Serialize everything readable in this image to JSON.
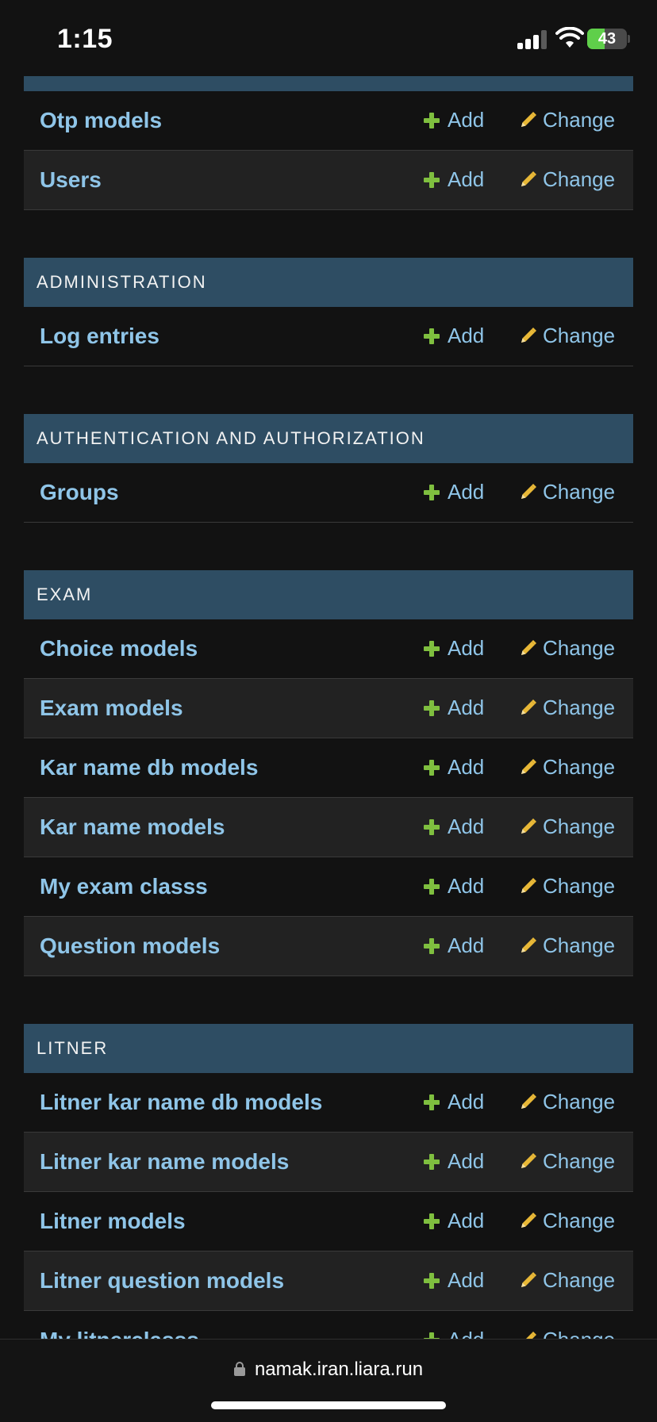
{
  "status": {
    "time": "1:15",
    "battery": "43",
    "battery_level": 0.43
  },
  "colors": {
    "header_bg": "#2e4d63",
    "link": "#8fc5e8",
    "add_icon": "#7fbf3f",
    "change_icon": "#e8b837",
    "background": "#121212"
  },
  "common": {
    "add_label": "Add",
    "change_label": "Change"
  },
  "top_module": {
    "rows": [
      {
        "title": "Otp models"
      },
      {
        "title": "Users"
      }
    ]
  },
  "modules": [
    {
      "header": "ADMINISTRATION",
      "rows": [
        {
          "title": "Log entries"
        }
      ]
    },
    {
      "header": "AUTHENTICATION AND AUTHORIZATION",
      "rows": [
        {
          "title": "Groups"
        }
      ]
    },
    {
      "header": "EXAM",
      "rows": [
        {
          "title": "Choice models"
        },
        {
          "title": "Exam models"
        },
        {
          "title": "Kar name db models"
        },
        {
          "title": "Kar name models"
        },
        {
          "title": "My exam classs"
        },
        {
          "title": "Question models"
        }
      ]
    },
    {
      "header": "LITNER",
      "rows": [
        {
          "title": "Litner kar name db models"
        },
        {
          "title": "Litner kar name models"
        },
        {
          "title": "Litner models"
        },
        {
          "title": "Litner question models"
        },
        {
          "title": "My litnerclasss"
        }
      ]
    }
  ],
  "browser": {
    "url": "namak.iran.liara.run",
    "lock_icon": "lock-icon"
  }
}
